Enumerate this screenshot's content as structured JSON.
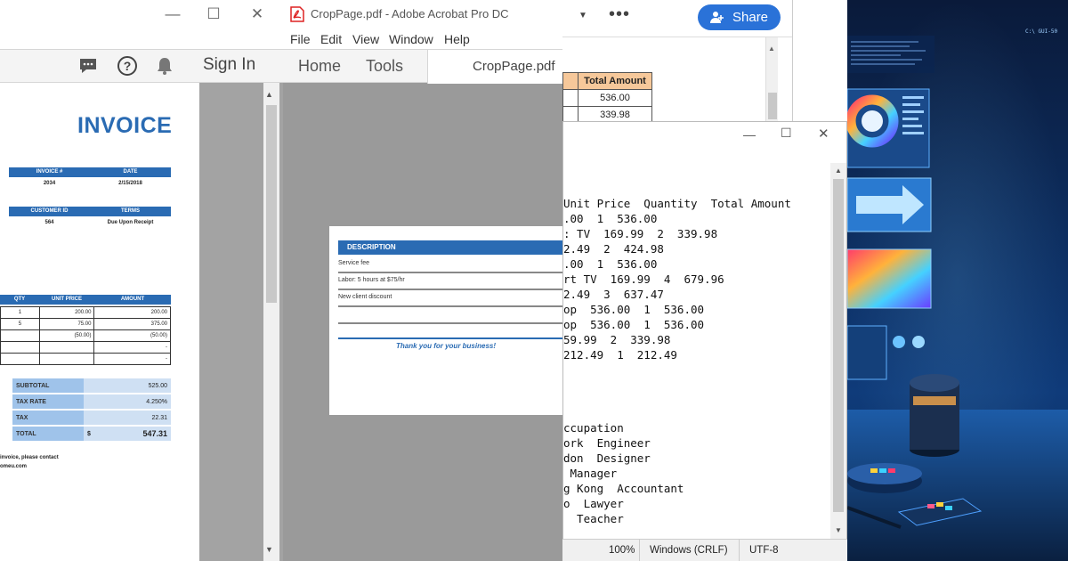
{
  "panel1": {
    "signin_label": "Sign In",
    "invoice": {
      "title": "INVOICE",
      "hdr1": [
        "INVOICE #",
        "DATE"
      ],
      "val1": [
        "2034",
        "2/15/2018"
      ],
      "hdr2": [
        "CUSTOMER ID",
        "TERMS"
      ],
      "val2": [
        "564",
        "Due Upon Receipt"
      ],
      "line_headers": [
        "QTY",
        "UNIT PRICE",
        "AMOUNT"
      ],
      "lines": [
        [
          "1",
          "200.00",
          "200.00"
        ],
        [
          "5",
          "75.00",
          "375.00"
        ],
        [
          "",
          "(50.00)",
          "(50.00)"
        ],
        [
          "",
          "",
          "-"
        ],
        [
          "",
          "",
          "-"
        ]
      ],
      "totals": [
        {
          "label": "SUBTOTAL",
          "value": "525.00"
        },
        {
          "label": "TAX RATE",
          "value": "4.250%"
        },
        {
          "label": "TAX",
          "value": "22.31"
        },
        {
          "label": "TOTAL",
          "cur": "$",
          "value": "547.31"
        }
      ],
      "footer1": "invoice, please contact",
      "footer2": "omeu.com"
    }
  },
  "panel2": {
    "window_title": "CropPage.pdf - Adobe Acrobat Pro DC",
    "menu": [
      "File",
      "Edit",
      "View",
      "Window",
      "Help"
    ],
    "tabs": {
      "home": "Home",
      "tools": "Tools",
      "doc": "CropPage.pdf"
    },
    "page": {
      "desc_header": "DESCRIPTION",
      "rows": [
        "Service fee",
        "Labor: 5 hours at $75/hr",
        "New client discount"
      ],
      "thanks": "Thank you for your business!"
    }
  },
  "panel3": {
    "share_label": "Share",
    "excel": {
      "header": "Total Amount",
      "values": [
        "536.00",
        "339.98"
      ]
    },
    "notepad_lines": [
      "Unit Price  Quantity  Total Amount",
      ".00  1  536.00",
      ": TV  169.99  2  339.98",
      "2.49  2  424.98",
      ".00  1  536.00",
      "rt TV  169.99  4  679.96",
      "2.49  3  637.47",
      "op  536.00  1  536.00",
      "op  536.00  1  536.00",
      "59.99  2  339.98",
      "212.49  1  212.49",
      "",
      "",
      "",
      "ccupation",
      "ork  Engineer",
      "don  Designer",
      " Manager",
      "g Kong  Accountant",
      "o  Lawyer",
      "  Teacher"
    ],
    "status": {
      "zoom": "100%",
      "eol": "Windows (CRLF)",
      "encoding": "UTF-8"
    }
  },
  "panel4": {
    "corner_text": "C:\\  GUI-50"
  }
}
